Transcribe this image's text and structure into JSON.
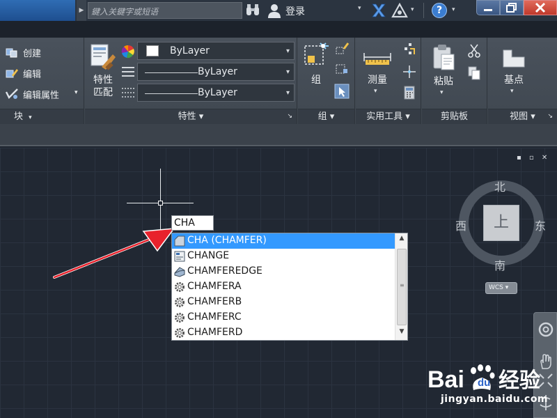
{
  "titlebar": {
    "search_placeholder": "鍵入关鍵字或短语",
    "login_label": "登录",
    "caret": "▾",
    "help_label": "?"
  },
  "ribbon": {
    "block_panel": {
      "create_label": "创建",
      "edit_label": "编辑",
      "edit_attributes_label": "编辑属性",
      "footer_label": "块"
    },
    "properties_panel": {
      "match_label_line1": "特性",
      "match_label_line2": "匹配",
      "color_value": "ByLayer",
      "linetype_value": "ByLayer",
      "lineweight_value": "ByLayer",
      "footer_label": "特性 ▾"
    },
    "group_panel": {
      "group_label": "组",
      "footer_label": "组 ▾"
    },
    "utilities_panel": {
      "measure_label": "测量",
      "footer_label": "实用工具 ▾"
    },
    "clipboard_panel": {
      "paste_label": "粘贴",
      "footer_label": "剪贴板"
    },
    "view_panel": {
      "basepoint_label": "基点",
      "footer_label": "视图 ▾"
    }
  },
  "command": {
    "input_value": "CHA",
    "suggestions": [
      {
        "label": "CHA (CHAMFER)",
        "icon": "chamfer-icon",
        "selected": true
      },
      {
        "label": "CHANGE",
        "icon": "properties-icon",
        "selected": false
      },
      {
        "label": "CHAMFEREDGE",
        "icon": "chamfer-edge-icon",
        "selected": false
      },
      {
        "label": "CHAMFERA",
        "icon": "gear-icon",
        "selected": false
      },
      {
        "label": "CHAMFERB",
        "icon": "gear-icon",
        "selected": false
      },
      {
        "label": "CHAMFERC",
        "icon": "gear-icon",
        "selected": false
      },
      {
        "label": "CHAMFERD",
        "icon": "gear-icon",
        "selected": false
      }
    ]
  },
  "viewcube": {
    "north": "北",
    "south": "南",
    "west": "西",
    "east": "东",
    "top_face": "上",
    "wcs_label": "WCS ▾"
  },
  "canvas": {
    "window_controls": "▪ ▫ ✕"
  },
  "watermark": {
    "logo_text": "Bai du 经验",
    "url": "jingyan.baidu.com"
  },
  "colors": {
    "selection": "#3399ff",
    "arrow": "#e8222c",
    "title_accent": "#2f6db4"
  }
}
